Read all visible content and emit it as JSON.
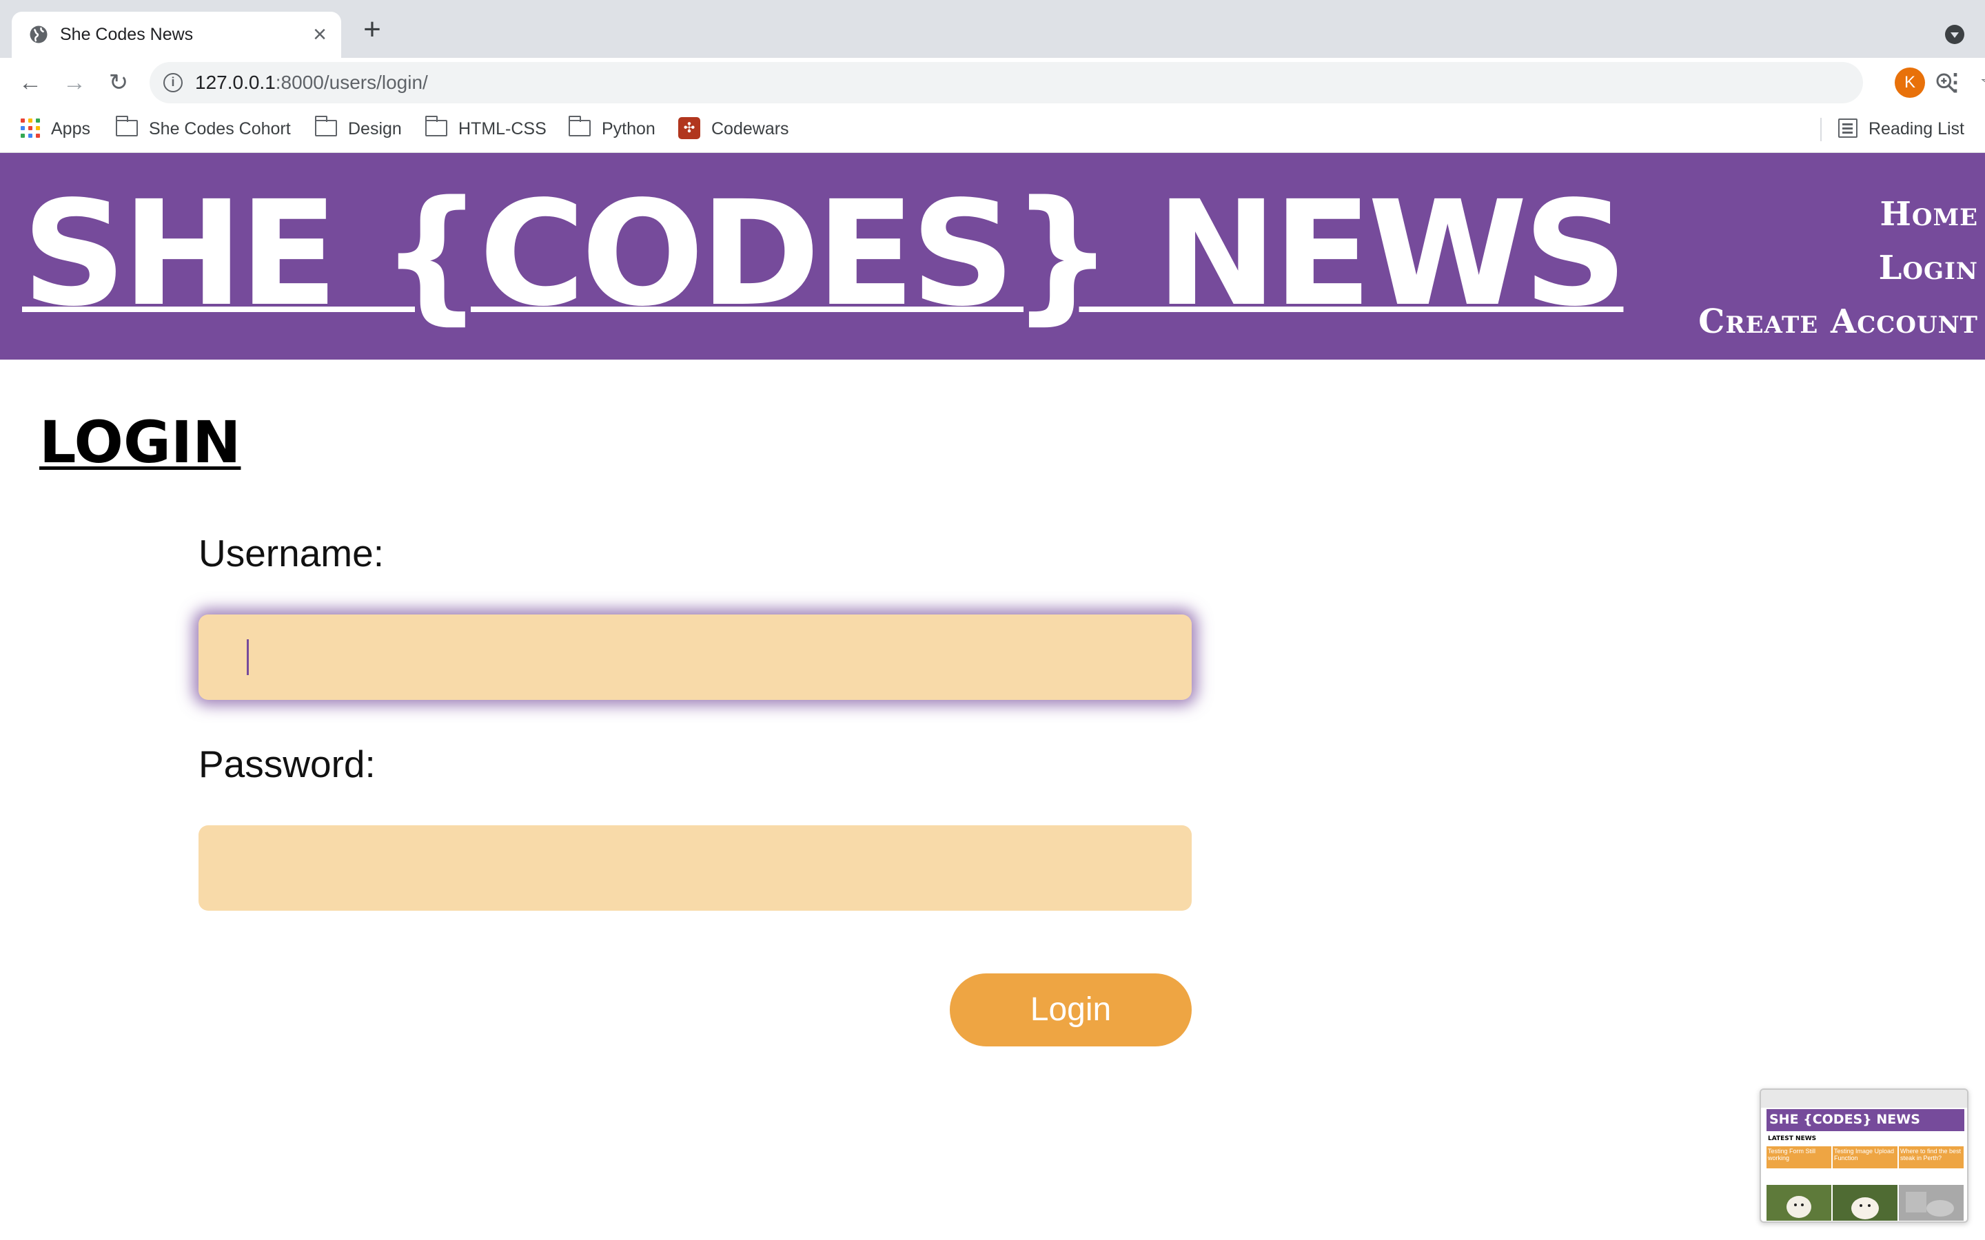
{
  "browser": {
    "tab": {
      "title": "She Codes News",
      "favicon": "globe-icon"
    },
    "url": {
      "host": "127.0.0.1",
      "rest": ":8000/users/login/"
    },
    "profile_initial": "K",
    "bookmarks": [
      {
        "label": "Apps",
        "icon": "apps-grid-icon"
      },
      {
        "label": "She Codes Cohort",
        "icon": "folder-icon"
      },
      {
        "label": "Design",
        "icon": "folder-icon"
      },
      {
        "label": "HTML-CSS",
        "icon": "folder-icon"
      },
      {
        "label": "Python",
        "icon": "folder-icon"
      },
      {
        "label": "Codewars",
        "icon": "codewars-icon"
      }
    ],
    "reading_list": "Reading List"
  },
  "site": {
    "title": "SHE {CODES} NEWS",
    "nav": [
      "Home",
      "Login",
      "Create Account"
    ],
    "header_color": "#764b9b"
  },
  "page": {
    "heading": "LOGIN",
    "form": {
      "username_label": "Username:",
      "username_value": "",
      "password_label": "Password:",
      "password_value": "",
      "submit_label": "Login",
      "input_color": "#f8daa9",
      "button_color": "#eea543"
    }
  },
  "thumbnail": {
    "title": "SHE {CODES} NEWS",
    "section": "LATEST NEWS",
    "cards": [
      "Testing Form Still working",
      "Testing Image Upload Function",
      "Where to find the best steak in Perth?"
    ]
  }
}
